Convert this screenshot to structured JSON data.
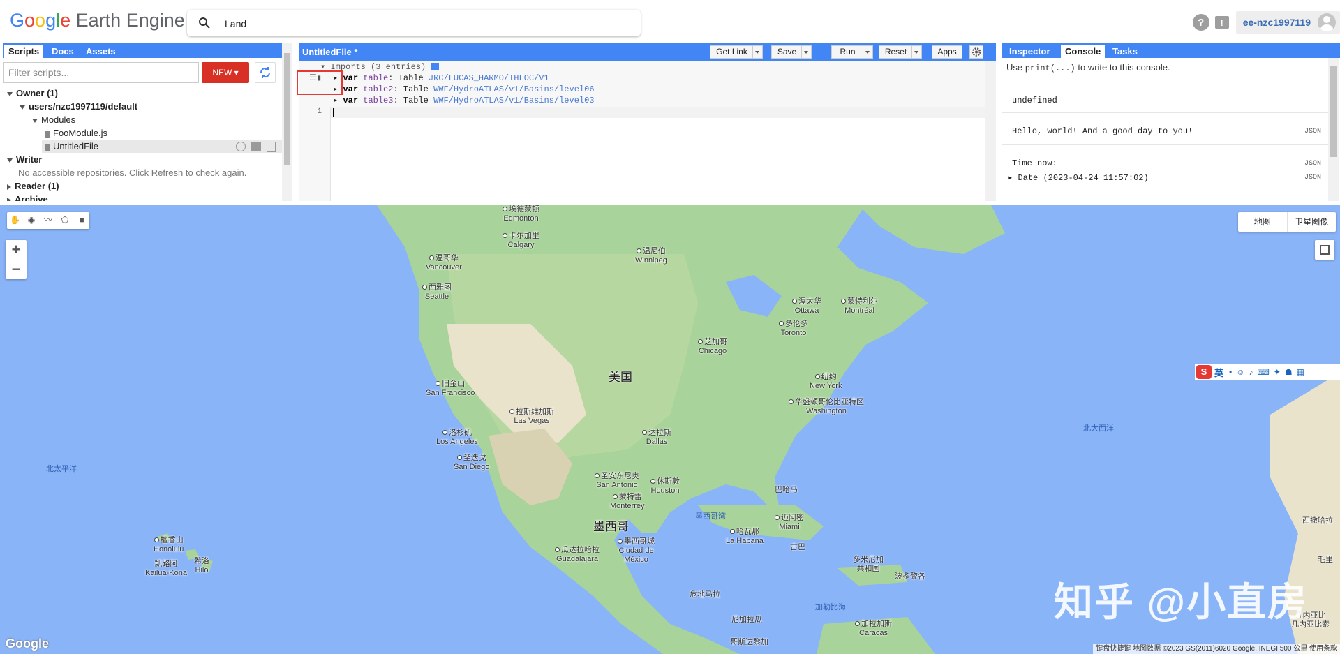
{
  "header": {
    "logo_google": "Google",
    "logo_product": "Earth Engine",
    "search_value": "Land",
    "help_glyph": "?",
    "feedback_glyph": "!",
    "account": "ee-nzc1997119"
  },
  "left_panel": {
    "tabs": [
      "Scripts",
      "Docs",
      "Assets"
    ],
    "active_tab": "Scripts",
    "filter_placeholder": "Filter scripts...",
    "new_button": "NEW",
    "tree": {
      "owner": "Owner (1)",
      "repo": "users/nzc1997119/default",
      "folder": "Modules",
      "file1": "FooModule.js",
      "file2": "UntitledFile",
      "writer": "Writer",
      "writer_note": "No accessible repositories. Click Refresh to check again.",
      "reader": "Reader (1)",
      "archive": "Archive"
    }
  },
  "editor": {
    "title": "UntitledFile *",
    "buttons": {
      "get_link": "Get Link",
      "save": "Save",
      "run": "Run",
      "reset": "Reset",
      "apps": "Apps"
    },
    "imports_header": "Imports (3 entries)",
    "imports": [
      {
        "kw": "var",
        "name": "table",
        "type": ": Table ",
        "asset": "JRC/LUCAS_HARMO/THLOC/V1"
      },
      {
        "kw": "var",
        "name": "table2",
        "type": ": Table ",
        "asset": "WWF/HydroATLAS/v1/Basins/level06"
      },
      {
        "kw": "var",
        "name": "table3",
        "type": ": Table ",
        "asset": "WWF/HydroATLAS/v1/Basins/level03"
      }
    ],
    "line_number": "1"
  },
  "right_panel": {
    "tabs": [
      "Inspector",
      "Console",
      "Tasks"
    ],
    "active_tab": "Console",
    "hint_prefix": "Use ",
    "hint_code": "print(...)",
    "hint_suffix": " to write to this console.",
    "entries": {
      "e1": "undefined",
      "e2": "Hello, world!  And a good day to you!",
      "e3": "Time now:",
      "e4": "Date (2023-04-24 11:57:02)"
    },
    "json_label": "JSON"
  },
  "map": {
    "map_type": [
      "地图",
      "卫星图像"
    ],
    "zoom_in": "+",
    "zoom_out": "−",
    "labels": {
      "edmonton": "埃德蒙顿\nEdmonton",
      "calgary": "卡尔加里\nCalgary",
      "vancouver": "温哥华\nVancouver",
      "seattle": "西雅图\nSeattle",
      "winnipeg": "温尼伯\nWinnipeg",
      "ottawa": "渥太华\nOttawa",
      "montreal": "蒙特利尔\nMontréal",
      "toronto": "多伦多\nToronto",
      "chicago": "芝加哥\nChicago",
      "newyork": "纽约\nNew York",
      "washington": "华盛顿哥伦比亚特区\nWashington",
      "sanfrancisco": "旧金山\nSan Francisco",
      "lasvegas": "拉斯维加斯\nLas Vegas",
      "losangeles": "洛杉矶\nLos Angeles",
      "sandiego": "圣迭戈\nSan Diego",
      "dallas": "达拉斯\nDallas",
      "sanantonio": "圣安东尼奥\nSan Antonio",
      "houston": "休斯敦\nHouston",
      "monterrey": "蒙特雷\nMonterrey",
      "miami": "迈阿密\nMiami",
      "havana": "哈瓦那\nLa Habana",
      "cuba": "古巴",
      "guadalajara": "瓜达拉哈拉\nGuadalajara",
      "mexicocity": "墨西哥城\nCiudad de\nMéxico",
      "honolulu": "檀香山\nHonolulu",
      "hilo": "希洛\nHilo",
      "kailua": "凯路阿\nKailua-Kona",
      "guatemala": "危地马拉",
      "nicaragua": "尼加拉瓜",
      "caracas": "加拉加斯\nCaracas",
      "dominican": "多米尼加\n共和国",
      "dominica": "波多黎各",
      "colombia": "哥斯达黎加",
      "westafrica": "西撒哈拉",
      "mauritania": "毛里",
      "usa": "美国",
      "mexico": "墨西哥",
      "pacific": "北太平洋",
      "atlantic": "北大西洋",
      "gulf": "墨西哥湾",
      "caribbean": "加勒比海",
      "bahamas": "巴哈马",
      "andes": "几内亚比\n几内亚比索"
    },
    "watermark": "知乎 @小直房",
    "google": "Google",
    "attribution": "键盘快捷键  地图数据 ©2023 GS(2011)6020 Google, INEGI  500 公里  使用条款",
    "ime": "英"
  }
}
